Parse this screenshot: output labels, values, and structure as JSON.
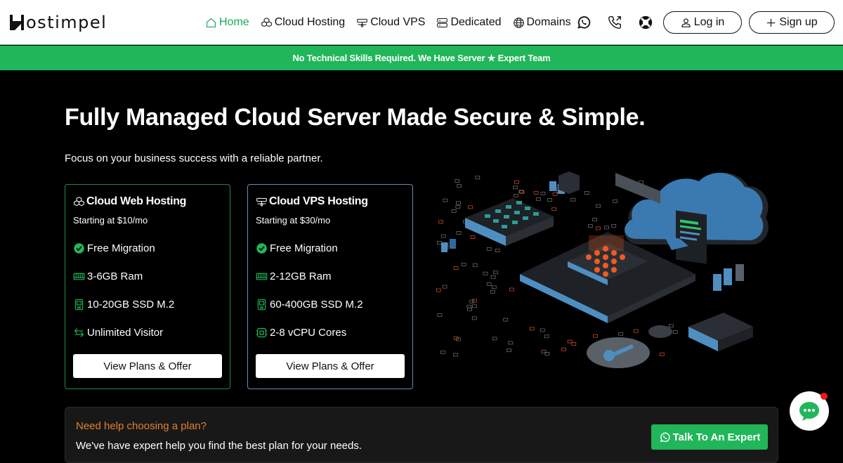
{
  "brand": {
    "name": "ostimpel",
    "logo_letter": "H"
  },
  "nav": {
    "items": [
      {
        "label": "Home",
        "icon": "home-icon",
        "active": true
      },
      {
        "label": "Cloud Hosting",
        "icon": "cubes-icon",
        "active": false
      },
      {
        "label": "Cloud VPS",
        "icon": "server-icon",
        "active": false
      },
      {
        "label": "Dedicated",
        "icon": "database-icon",
        "active": false
      },
      {
        "label": "Domains",
        "icon": "globe-icon",
        "active": false
      }
    ],
    "icons": [
      "whatsapp-icon",
      "phone-outgoing-icon",
      "life-ring-icon"
    ],
    "login_label": "Log in",
    "signup_label": "Sign up"
  },
  "banner": {
    "text": "No Technical Skills Required. We Have Server ★ Expert Team"
  },
  "hero": {
    "title": "Fully Managed Cloud Server Made Secure & Simple.",
    "subtitle": "Focus on your business success with a reliable partner."
  },
  "cards": [
    {
      "title": "Cloud Web Hosting",
      "price": "Starting at $10/mo",
      "features": [
        {
          "label": "Free Migration",
          "icon": "check-circle-icon"
        },
        {
          "label": "3-6GB Ram",
          "icon": "memory-icon"
        },
        {
          "label": "10-20GB SSD M.2",
          "icon": "ssd-icon"
        },
        {
          "label": "Unlimited Visitor",
          "icon": "arrows-exchange-icon"
        }
      ],
      "button": "View Plans & Offer"
    },
    {
      "title": "Cloud VPS Hosting",
      "price": "Starting at $30/mo",
      "features": [
        {
          "label": "Free Migration",
          "icon": "check-circle-icon"
        },
        {
          "label": "2-12GB Ram",
          "icon": "memory-icon"
        },
        {
          "label": "60-400GB SSD M.2",
          "icon": "ssd-icon"
        },
        {
          "label": "2-8 vCPU Cores",
          "icon": "cpu-icon"
        }
      ],
      "button": "View Plans & Offer"
    }
  ],
  "help": {
    "title": "Need help choosing a plan?",
    "text": "We've have expert help you find the best plan for your needs.",
    "button": "Talk To An Expert"
  },
  "colors": {
    "accent_green": "#21b65a",
    "help_orange": "#e57f2b",
    "card_green_border": "#1f8a4a",
    "card_blue_border": "#6a8cb0"
  }
}
